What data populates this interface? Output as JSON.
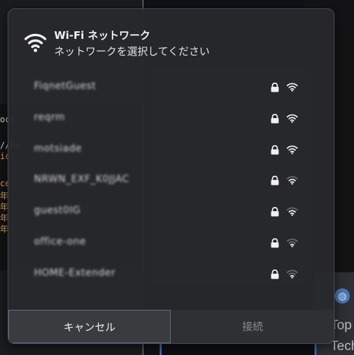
{
  "dialog": {
    "title": "Wi-Fi ネットワーク",
    "subtitle": "ネットワークを選択してください",
    "networks": [
      {
        "name": "FiqnetGuest",
        "secured": true,
        "signal": 4
      },
      {
        "name": "reqrm",
        "secured": true,
        "signal": 4
      },
      {
        "name": "motsiade",
        "secured": true,
        "signal": 4
      },
      {
        "name": "NRWN_EXF_K0JJAC",
        "secured": true,
        "signal": 3
      },
      {
        "name": "guest0IG",
        "secured": true,
        "signal": 3
      },
      {
        "name": "office-one",
        "secured": true,
        "signal": 2
      },
      {
        "name": "HOME-Extender",
        "secured": true,
        "signal": 2
      }
    ],
    "cancel_label": "キャンセル",
    "connect_label": "接続"
  },
  "background": {
    "right_text_1": "Top",
    "right_text_2": "Tech"
  },
  "icons": {
    "header": "wifi-icon",
    "lock": "lock-icon",
    "signal": "wifi-signal-icon",
    "globe": "globe-icon"
  },
  "colors": {
    "dialog_bg": "#28292c",
    "accent_border": "#5c6f8a",
    "text": "#f2f2f2",
    "disabled_text": "#8c8c8c"
  }
}
